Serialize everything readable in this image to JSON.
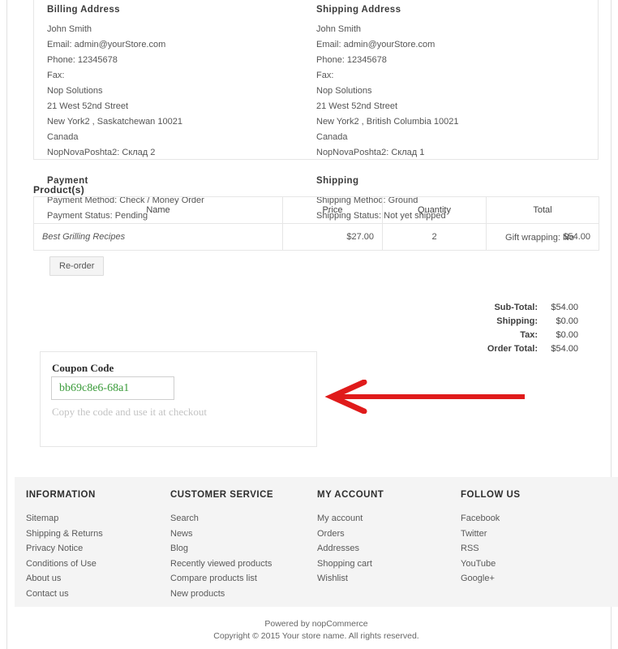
{
  "order": {
    "billing": {
      "title": "Billing Address",
      "lines": [
        "John Smith",
        "Email: admin@yourStore.com",
        "Phone: 12345678",
        "Fax:",
        "Nop Solutions",
        "21 West 52nd Street",
        "New York2 , Saskatchewan 10021",
        "Canada",
        "NopNovaPoshta2: Склад 2"
      ],
      "sub_title": "Payment",
      "sub_lines": [
        "Payment Method: Check / Money Order",
        "Payment Status: Pending"
      ]
    },
    "shipping": {
      "title": "Shipping Address",
      "lines": [
        "John Smith",
        "Email: admin@yourStore.com",
        "Phone: 12345678",
        "Fax:",
        "Nop Solutions",
        "21 West 52nd Street",
        "New York2 , British Columbia 10021",
        "Canada",
        "NopNovaPoshta2: Склад 1"
      ],
      "sub_title": "Shipping",
      "sub_lines": [
        "Shipping Method: Ground",
        "Shipping Status: Not yet shipped"
      ]
    }
  },
  "products": {
    "title": "Product(s)",
    "headers": [
      "Name",
      "Price",
      "Quantity",
      "Total"
    ],
    "rows": [
      {
        "name": "Best Grilling Recipes",
        "price": "$27.00",
        "quantity": "2",
        "total": "$54.00"
      }
    ],
    "gift_wrapping": "Gift wrapping: No",
    "reorder_label": "Re-order"
  },
  "totals": [
    {
      "label": "Sub-Total:",
      "value": "$54.00"
    },
    {
      "label": "Shipping:",
      "value": "$0.00"
    },
    {
      "label": "Tax:",
      "value": "$0.00"
    },
    {
      "label": "Order Total:",
      "value": "$54.00"
    }
  ],
  "coupon": {
    "label": "Coupon Code",
    "code": "bb69c8e6-68a1",
    "hint": "Copy the code and use it at checkout",
    "code_color": "#3a9b3a"
  },
  "annotation": {
    "arrow_color": "#e01b1b",
    "direction": "left"
  },
  "footer": {
    "columns": [
      {
        "title": "INFORMATION",
        "links": [
          "Sitemap",
          "Shipping & Returns",
          "Privacy Notice",
          "Conditions of Use",
          "About us",
          "Contact us"
        ]
      },
      {
        "title": "CUSTOMER SERVICE",
        "links": [
          "Search",
          "News",
          "Blog",
          "Recently viewed products",
          "Compare products list",
          "New products"
        ]
      },
      {
        "title": "MY ACCOUNT",
        "links": [
          "My account",
          "Orders",
          "Addresses",
          "Shopping cart",
          "Wishlist"
        ]
      },
      {
        "title": "FOLLOW US",
        "links": [
          "Facebook",
          "Twitter",
          "RSS",
          "YouTube",
          "Google+"
        ]
      }
    ],
    "powered_by": "Powered by nopCommerce",
    "copyright": "Copyright © 2015 Your store name. All rights reserved."
  }
}
